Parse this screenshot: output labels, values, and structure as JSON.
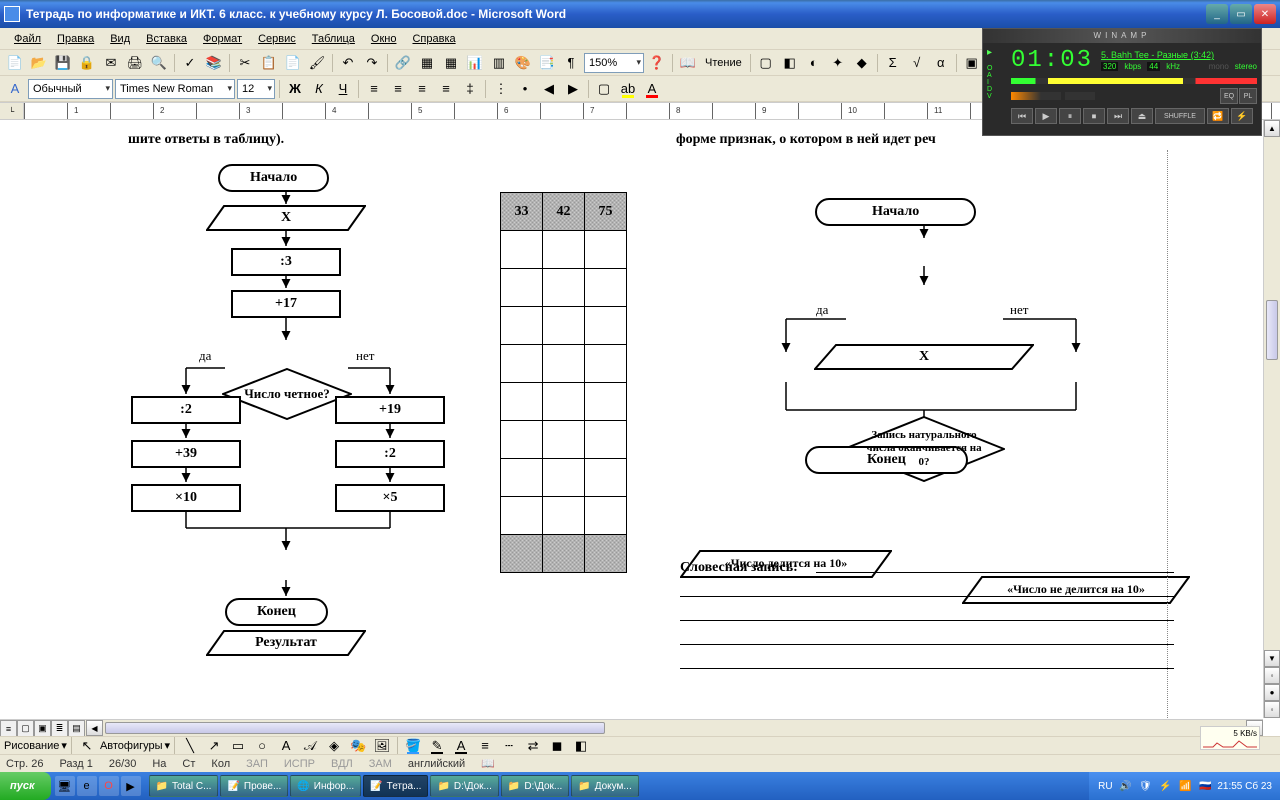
{
  "title": "Тетрадь по информатике и ИКТ. 6 класс. к учебному курсу Л. Босовой.doc - Microsoft Word",
  "menu": {
    "file": "Файл",
    "edit": "Правка",
    "view": "Вид",
    "insert": "Вставка",
    "format": "Формат",
    "service": "Сервис",
    "table": "Таблица",
    "window": "Окно",
    "help": "Справка"
  },
  "tb1": {
    "zoom": "150%",
    "reading": "Чтение"
  },
  "tb2": {
    "style": "Обычный",
    "font": "Times New Roman",
    "size": "12"
  },
  "ruler_nums": [
    "1",
    "2",
    "3",
    "4",
    "5",
    "6",
    "7",
    "8",
    "9",
    "10",
    "11"
  ],
  "flow1": {
    "start": "Начало",
    "x": "X",
    "d3": ":3",
    "p17": "+17",
    "cond": "Число четное?",
    "yes": "да",
    "no": "нет",
    "l1": ":2",
    "l2": "+39",
    "l3": "×10",
    "r1": "+19",
    "r2": ":2",
    "r3": "×5",
    "result": "Результат",
    "end": "Конец"
  },
  "tablecells": [
    "33",
    "42",
    "75"
  ],
  "flow2": {
    "start": "Начало",
    "x": "X",
    "cond": "Запись натурального числа оканчивается на 0?",
    "yes": "да",
    "no": "нет",
    "l": "«Число делится на 10»",
    "r": "«Число не делится на 10»",
    "end": "Конец"
  },
  "doctext": {
    "left_top": "шите ответы в таблицу).",
    "right_top": "форме признак, о котором в ней идет реч",
    "verbal": "Словесная запись:"
  },
  "drawbar": {
    "drawing": "Рисование",
    "autoshapes": "Автофигуры"
  },
  "status": {
    "page": "Стр. 26",
    "section": "Разд 1",
    "pages": "26/30",
    "at": "На",
    "line": "Ст",
    "col": "Кол",
    "zap": "ЗАП",
    "ispr": "ИСПР",
    "vdl": "ВДЛ",
    "zam": "ЗАМ",
    "lang": "английский"
  },
  "net": "5 KB/s",
  "taskbar": {
    "start": "пуск",
    "tasks": [
      "Total C...",
      "Прове...",
      "Инфор...",
      "Тетра...",
      "D:\\Док...",
      "D:\\Док...",
      "Докум..."
    ],
    "lang": "RU",
    "time": "21:55 Сб 23"
  },
  "winamp": {
    "title": "WINAMP",
    "time": "01:03",
    "track": "5. Bahh Tee - Разные (3:42)",
    "kbps": "320",
    "kbps_l": "kbps",
    "khz": "44",
    "khz_l": "kHz",
    "mono": "mono",
    "stereo": "stereo",
    "shuffle": "SHUFFLE"
  }
}
